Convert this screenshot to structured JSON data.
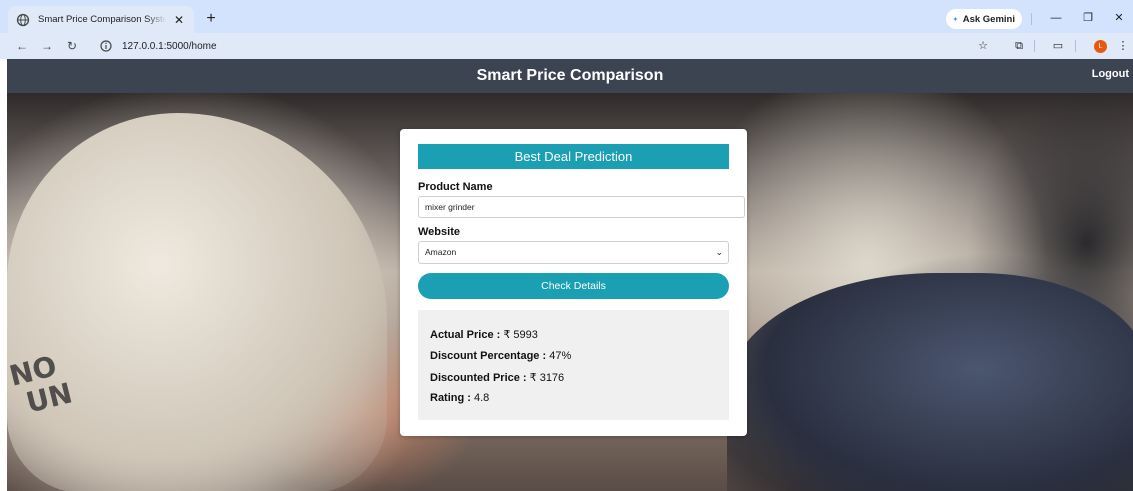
{
  "browser": {
    "tab_title": "Smart Price Comparison System",
    "tab_close": "✕",
    "new_tab": "+",
    "gemini_label": "Ask Gemini",
    "url": "127.0.0.1:5000/home",
    "profile_initial": "L",
    "icons": [
      "globe-icon",
      "back-icon",
      "forward-icon",
      "reload-icon",
      "info-icon",
      "star-icon",
      "extensions-icon",
      "reading-list-icon",
      "menu-icon"
    ]
  },
  "navbar": {
    "title": "Smart Price Comparison",
    "logout": "Logout"
  },
  "hero": {
    "text": "NO\nFUN"
  },
  "form": {
    "header": "Best Deal Prediction",
    "product_label": "Product Name",
    "product_value": "mixer grinder",
    "website_label": "Website",
    "website_selected": "Amazon",
    "submit_label": "Check Details"
  },
  "results": {
    "actual_label": "Actual Price :",
    "actual_value": "₹ 5993",
    "discount_label": "Discount Percentage :",
    "discount_value": "47%",
    "discounted_label": "Discounted Price :",
    "discounted_value": "₹ 3176",
    "rating_label": "Rating :",
    "rating_value": "4.8"
  },
  "colors": {
    "navbar_bg": "#3d4451",
    "accent": "#1b9fb3",
    "results_bg": "#f0f0f0"
  }
}
